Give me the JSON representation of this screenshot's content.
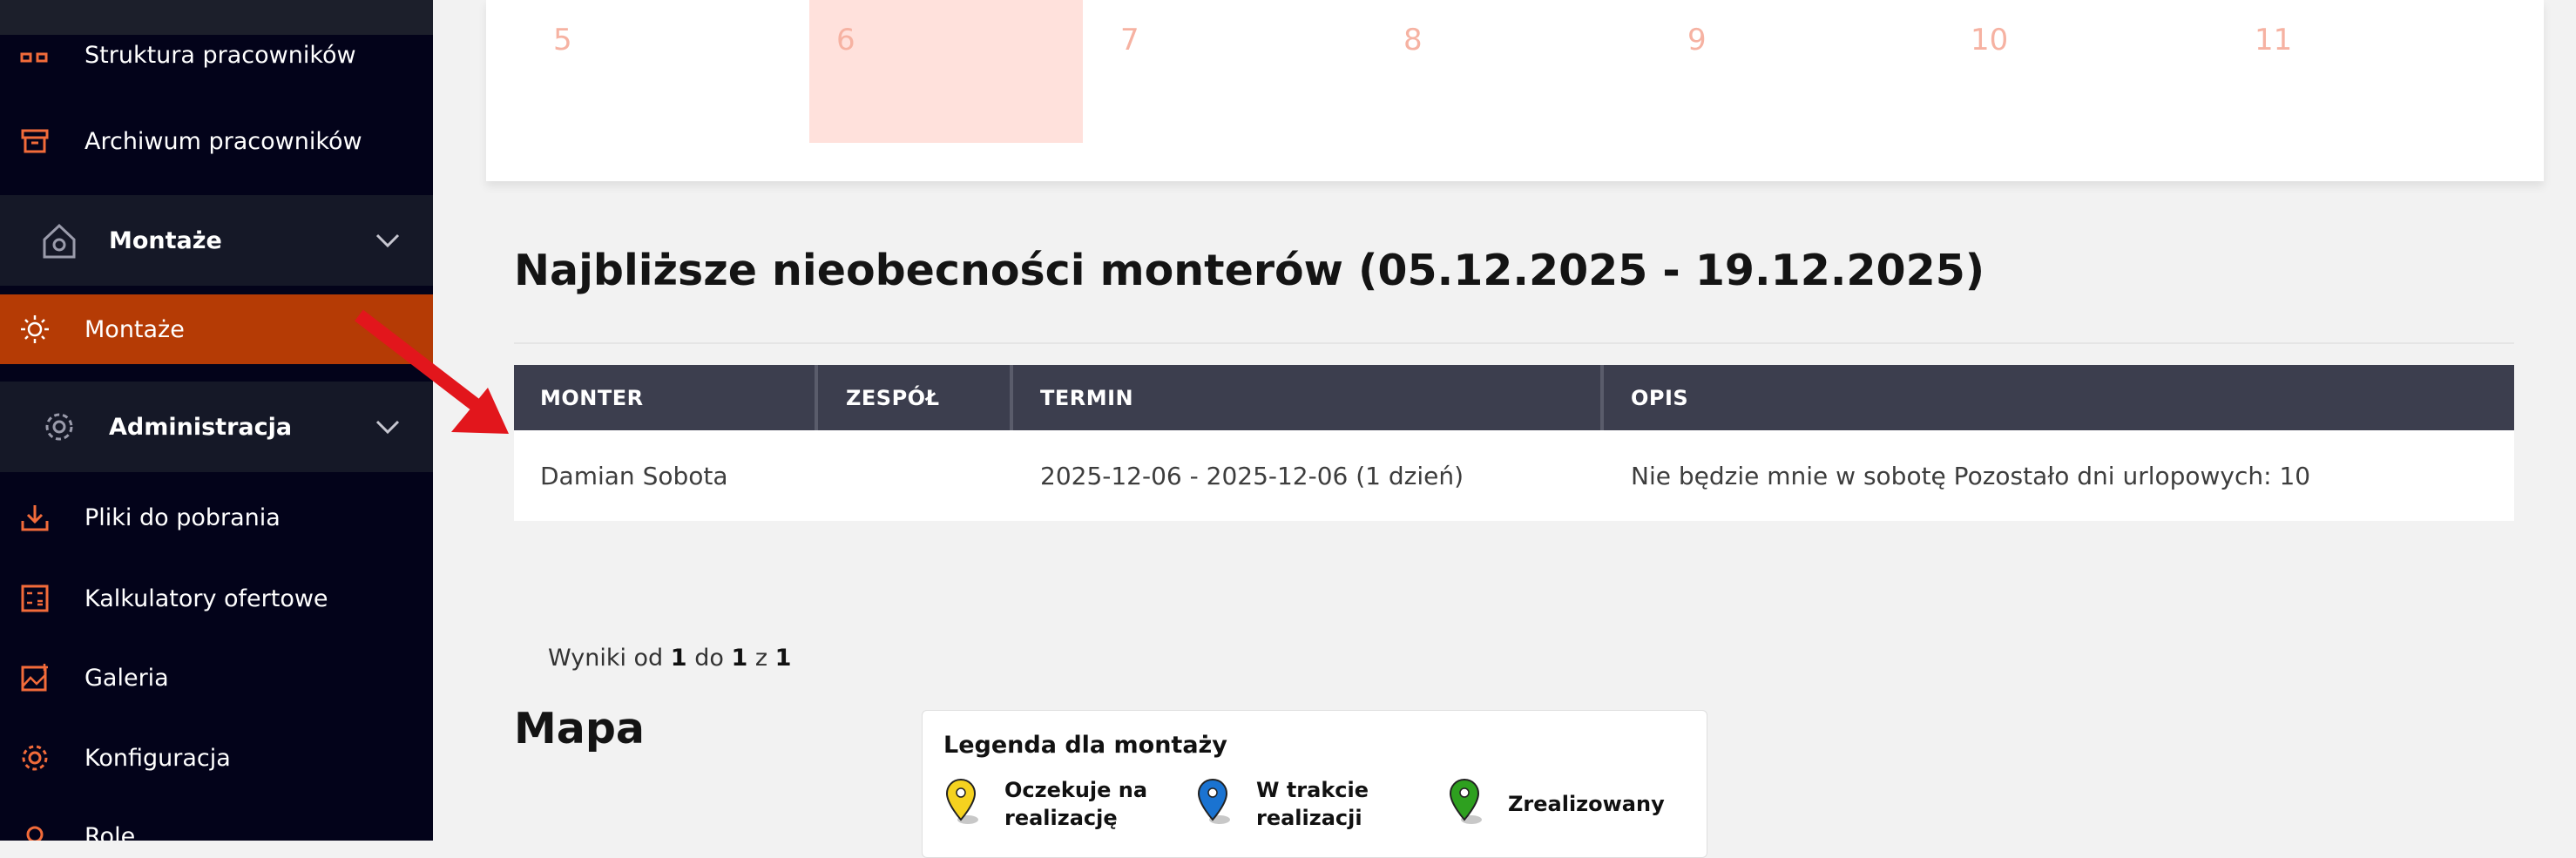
{
  "sidebar": {
    "items_top": [
      {
        "label": "Struktura pracowników",
        "icon": "structure-icon"
      },
      {
        "label": "Archiwum pracowników",
        "icon": "archive-icon"
      }
    ],
    "group_montaze": {
      "label": "Montaże",
      "icon": "house-icon"
    },
    "active_item": {
      "label": "Montaże",
      "icon": "sun-icon"
    },
    "group_admin": {
      "label": "Administracja",
      "icon": "gear-icon"
    },
    "items_bottom": [
      {
        "label": "Pliki do pobrania",
        "icon": "download-icon"
      },
      {
        "label": "Kalkulatory ofertowe",
        "icon": "calculator-icon"
      },
      {
        "label": "Galeria",
        "icon": "gallery-icon"
      },
      {
        "label": "Konfiguracja",
        "icon": "settings-icon"
      },
      {
        "label": "Role",
        "icon": "role-icon"
      }
    ]
  },
  "calendar": {
    "days": [
      "5",
      "6",
      "7",
      "8",
      "9",
      "10",
      "11"
    ],
    "highlighted_day": "6",
    "highlight_color": "#ffe1dc",
    "day_color": "#f6b2a2"
  },
  "absences": {
    "title": "Najbliższe nieobecności monterów (05.12.2025 - 19.12.2025)",
    "headers": {
      "monter": "MONTER",
      "zespol": "ZESPÓŁ",
      "termin": "TERMIN",
      "opis": "OPIS"
    },
    "rows": [
      {
        "monter": "Damian Sobota",
        "zespol": "",
        "termin": "2025-12-06 - 2025-12-06 (1 dzień)",
        "opis": "Nie będzie mnie w sobotę Pozostało dni urlopowych: 10"
      }
    ],
    "results": {
      "prefix": "Wyniki od",
      "from": "1",
      "mid": "do",
      "to": "1",
      "of": "z",
      "total": "1"
    }
  },
  "map": {
    "title": "Mapa",
    "legend_title": "Legenda dla montaży",
    "legend": [
      {
        "label": "Oczekuje na realizację",
        "color": "#f5d21f",
        "icon": "pin-yellow-icon"
      },
      {
        "label": "W trakcie realizacji",
        "color": "#1a73d1",
        "icon": "pin-blue-icon"
      },
      {
        "label": "Zrealizowany",
        "color": "#2ea01f",
        "icon": "pin-green-icon"
      }
    ]
  },
  "colors": {
    "sidebar_bg": "#03031a",
    "accent": "#b53b05",
    "icon_orange": "#f26b3a",
    "table_header": "#3c3e4e",
    "arrow": "#e2161c"
  }
}
